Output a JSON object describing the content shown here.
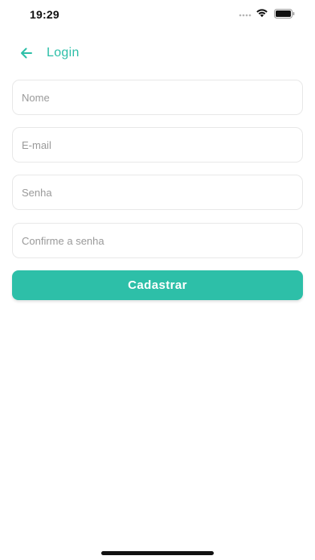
{
  "status_bar": {
    "time": "19:29",
    "icons": [
      "signal-icon",
      "wifi-icon",
      "battery-icon"
    ]
  },
  "header": {
    "back_icon": "arrow-left-icon",
    "title": "Login"
  },
  "form": {
    "name_placeholder": "Nome",
    "email_placeholder": "E-mail",
    "password_placeholder": "Senha",
    "confirm_placeholder": "Confirme a senha",
    "submit_label": "Cadastrar"
  },
  "colors": {
    "accent": "#2dbfa8",
    "field_border": "#e8e8e8",
    "placeholder": "#9a9a9a"
  }
}
